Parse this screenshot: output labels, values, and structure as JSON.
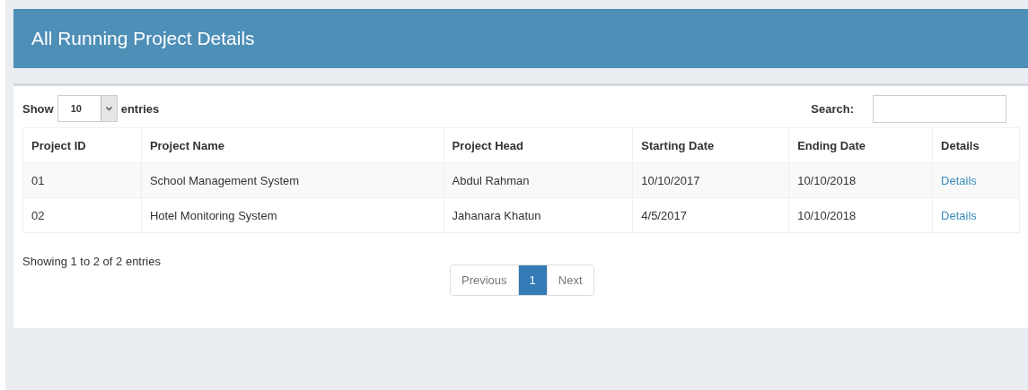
{
  "header": {
    "title": "All Running Project Details"
  },
  "length_menu": {
    "label_before": "Show",
    "value": "10",
    "label_after": "entries"
  },
  "search": {
    "label": "Search:"
  },
  "table": {
    "columns": [
      "Project ID",
      "Project Name",
      "Project Head",
      "Starting Date",
      "Ending Date",
      "Details"
    ],
    "rows": [
      {
        "cells": [
          "01",
          "School Management System",
          "Abdul Rahman",
          "10/10/2017",
          "10/10/2018"
        ],
        "action": "Details"
      },
      {
        "cells": [
          "02",
          "Hotel Monitoring System",
          "Jahanara Khatun",
          "4/5/2017",
          "10/10/2018"
        ],
        "action": "Details"
      }
    ]
  },
  "info": "Showing 1 to 2 of 2 entries",
  "pagination": [
    {
      "label": "Previous",
      "selected": false
    },
    {
      "label": "1",
      "selected": true
    },
    {
      "label": "Next",
      "selected": false
    }
  ]
}
